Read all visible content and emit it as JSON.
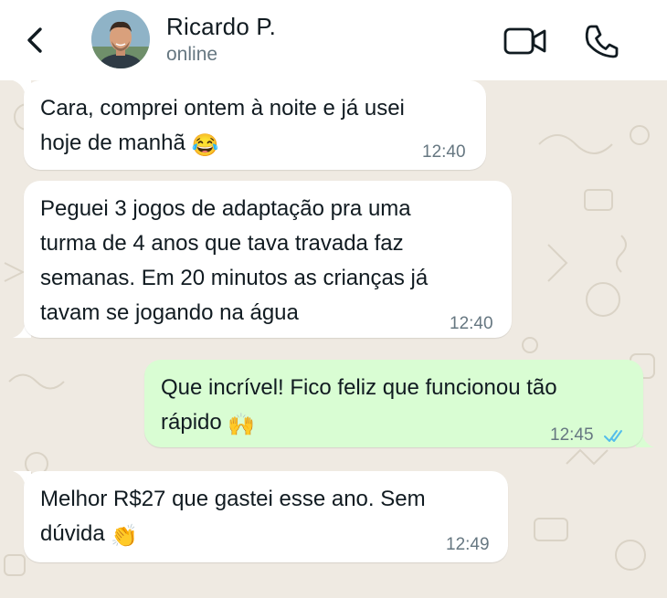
{
  "header": {
    "back_icon": "chevron-left-icon",
    "contact_name": "Ricardo P.",
    "status": "online",
    "video_icon": "video-camera-icon",
    "call_icon": "phone-icon"
  },
  "colors": {
    "incoming_bubble": "#ffffff",
    "outgoing_bubble": "#d9fdd3",
    "chat_background": "#efeae2",
    "read_ticks": "#53bdeb"
  },
  "messages": [
    {
      "direction": "incoming",
      "lines": [
        "Cara, comprei ontem à noite e já usei",
        "hoje de manhã"
      ],
      "emoji": "😂",
      "time": "12:40"
    },
    {
      "direction": "incoming",
      "lines": [
        "Peguei 3 jogos de adaptação pra uma",
        "turma de 4 anos que tava travada faz",
        "semanas. Em 20 minutos as crianças já",
        "tavam se jogando na água"
      ],
      "time": "12:40"
    },
    {
      "direction": "outgoing",
      "lines": [
        "Que incrível! Fico feliz que funcionou tão",
        "rápido"
      ],
      "emoji": "🙌",
      "time": "12:45",
      "status_icon": "double-check-read-icon"
    },
    {
      "direction": "incoming",
      "lines": [
        "Melhor R$27 que gastei esse ano. Sem",
        "dúvida"
      ],
      "emoji": "👏",
      "time": "12:49"
    }
  ]
}
